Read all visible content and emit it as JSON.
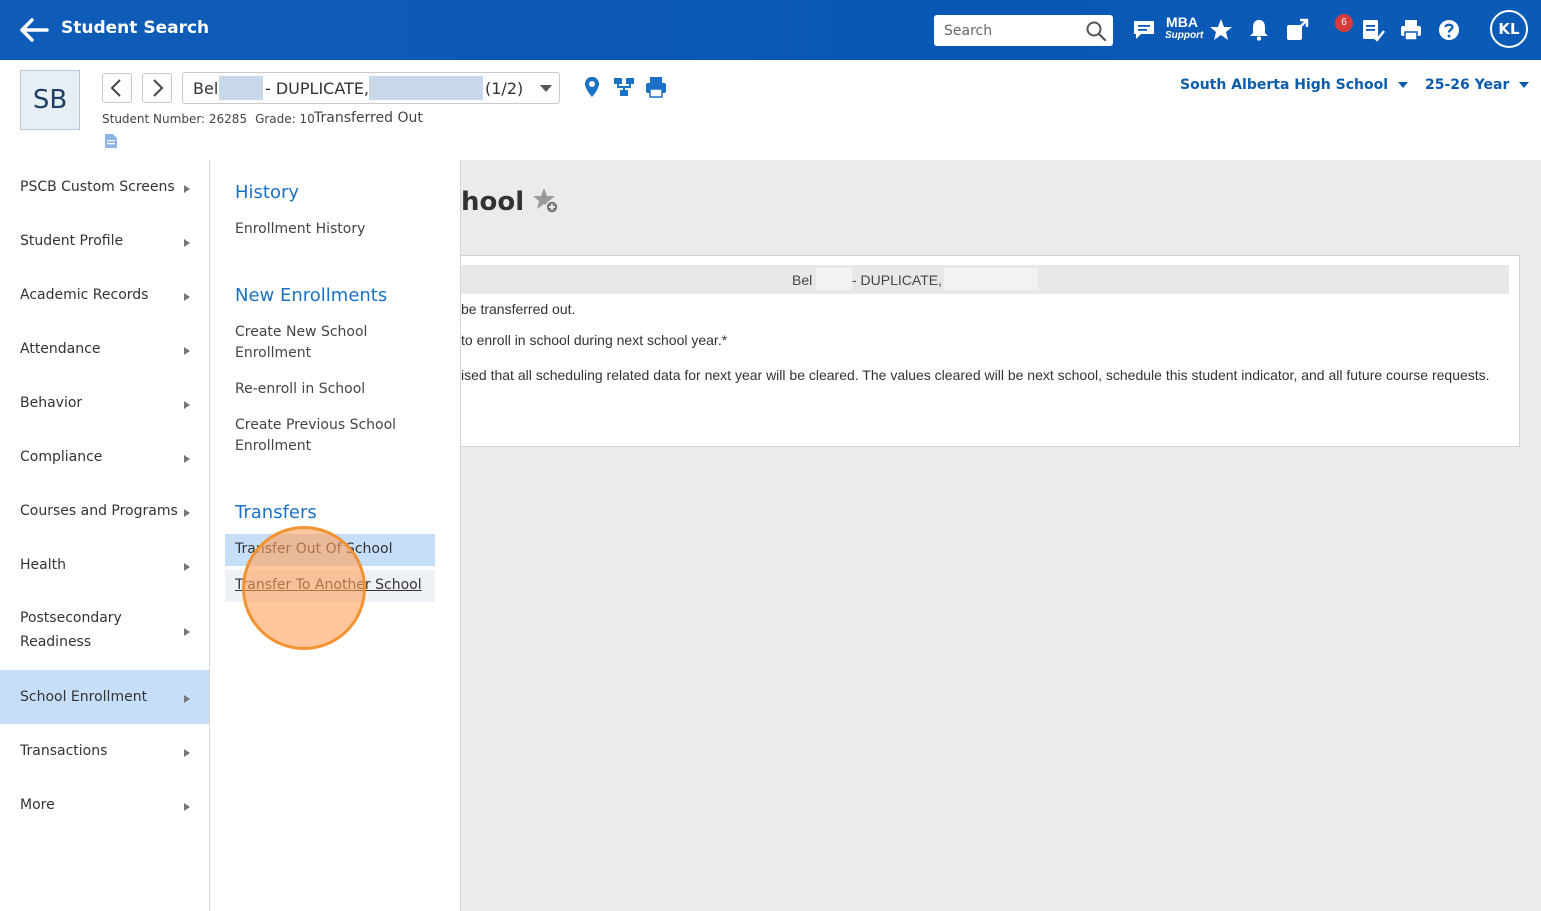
{
  "topbar": {
    "title": "Student Search",
    "search_placeholder": "Search",
    "mba_line1": "MBA",
    "mba_line2": "Support",
    "notification_count": "6",
    "user_initials": "KL"
  },
  "student": {
    "initials": "SB",
    "name_part1": "Bel",
    "name_part2": "- DUPLICATE,",
    "counter": "(1/2)",
    "student_number": "Student Number: 26285",
    "grade": "Grade: 10",
    "status": "Transferred Out",
    "school": "South Alberta High School",
    "year": "25-26 Year"
  },
  "leftnav": {
    "items": [
      {
        "label": "PSCB Custom Screens"
      },
      {
        "label": "Student Profile"
      },
      {
        "label": "Academic Records"
      },
      {
        "label": "Attendance"
      },
      {
        "label": "Behavior"
      },
      {
        "label": "Compliance"
      },
      {
        "label": "Courses and Programs"
      },
      {
        "label": "Health"
      },
      {
        "label_line1": "Postsecondary",
        "label_line2": "Readiness"
      },
      {
        "label": "School Enrollment"
      },
      {
        "label": "Transactions"
      },
      {
        "label": "More"
      }
    ]
  },
  "flyout": {
    "history_heading": "History",
    "enrollment_history": "Enrollment History",
    "new_enrollments_heading": "New Enrollments",
    "create_new_school_enrollment": "Create New School Enrollment",
    "reenroll_in_school": "Re-enroll in School",
    "create_previous_school_enrollment": "Create Previous School Enrollment",
    "transfers_heading": "Transfers",
    "transfer_out_of_school": "Transfer Out Of School",
    "transfer_to_another_school": "Transfer To Another School"
  },
  "main": {
    "page_title_partial": "hool",
    "panel_name_part1": "Bel",
    "panel_name_part2": "- DUPLICATE,",
    "line1": "be transferred out.",
    "line2": "to enroll in school during next school year.*",
    "line3": "ised that all scheduling related data for next year will be cleared. The values cleared will be next school, schedule this student indicator, and all future course requests."
  },
  "colors": {
    "topbar": "#0b5ab6",
    "accent": "#1a72c7",
    "nav_active": "#c7def8",
    "click_ring": "#f29332"
  }
}
